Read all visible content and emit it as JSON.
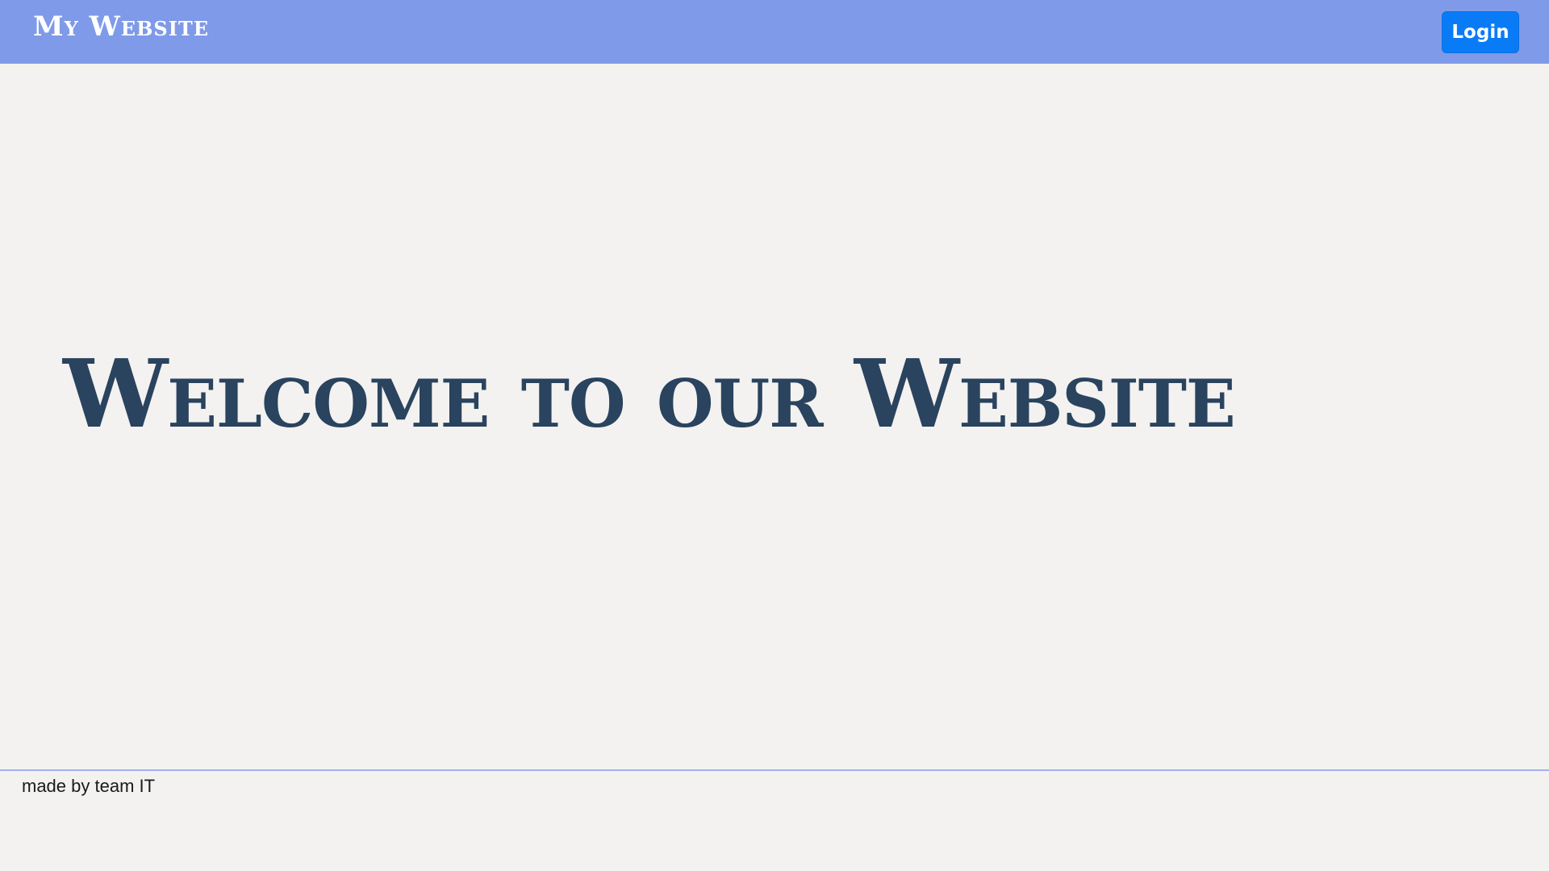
{
  "header": {
    "brand": "My Website",
    "login_label": "Login"
  },
  "hero": {
    "title": "Welcome to our Website"
  },
  "footer": {
    "text": "made by team IT"
  },
  "colors": {
    "navbar_background": "#7f9ae8",
    "page_background": "#f3f2f0",
    "login_button": "#0a7bf6",
    "hero_text": "#2a435e",
    "footer_divider": "#9fb2ec"
  }
}
